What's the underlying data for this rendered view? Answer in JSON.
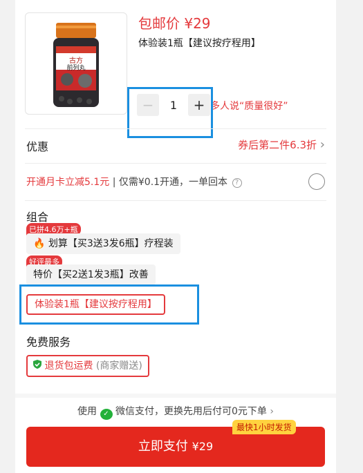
{
  "product": {
    "price_label": "包邮价 ¥29",
    "variant_title": "体验装1瓶【建议按疗程用】",
    "quantity": "1",
    "minus": "−",
    "plus": "+",
    "praise": "多人说“质量很好”",
    "bottle_brand": "古方",
    "bottle_name": "前列丸"
  },
  "discount": {
    "title": "优惠",
    "value": "券后第二件6.3折",
    "chevron": "›"
  },
  "monthly_card": {
    "offer": "开通月卡立减5.1元",
    "separator": "|",
    "detail": "仅需¥0.1开通，一单回本",
    "help": "?"
  },
  "combo": {
    "title": "组合",
    "options": [
      {
        "badge": "已拼4.6万+瓶",
        "icon": "flame-icon",
        "label": "划算【买3送3发6瓶】疗程装"
      },
      {
        "badge": "好评最多",
        "label": "特价【买2送1发3瓶】改善"
      },
      {
        "label": "体验装1瓶【建议按疗程用】",
        "selected": true
      }
    ]
  },
  "services": {
    "title": "免费服务",
    "item": "退货包运费",
    "note": "(商家赠送)"
  },
  "payment": {
    "use": "使用",
    "method": "微信支付，更换先用后付可0元下单",
    "chevron": "›",
    "button": "立即支付",
    "amount": "¥29",
    "ship_badge": "最快1小时发货"
  },
  "colors": {
    "accent": "#e4393c",
    "highlight": "#1a8fe0",
    "wechat": "#23b13a"
  }
}
